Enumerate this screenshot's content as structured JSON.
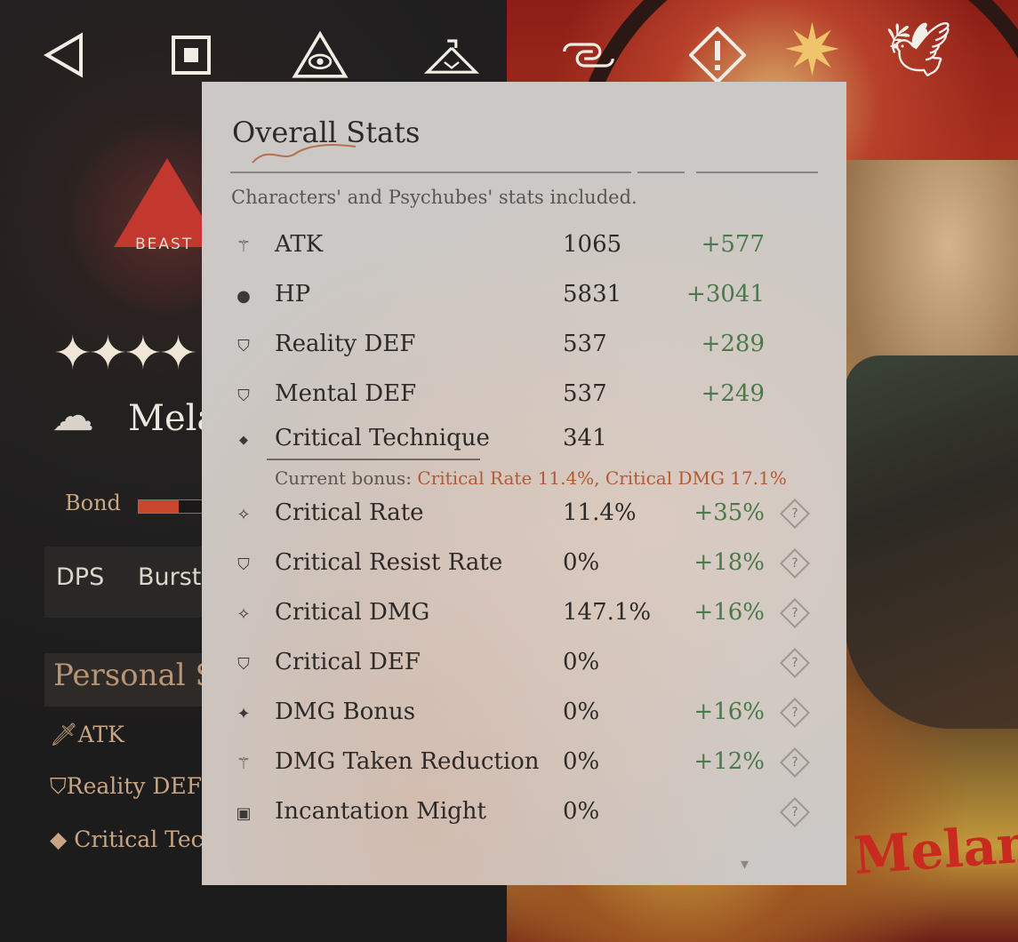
{
  "toolbar": {
    "back": "back-icon",
    "home": "home-icon",
    "eye": "eye-triangle-icon",
    "wardrobe": "hanger-icon",
    "link": "link-icon",
    "warning": "warning-icon"
  },
  "character": {
    "afflatus": "BEAST",
    "rarity": "✦✦✦✦",
    "name_partial": "Mela",
    "bond_label": "Bond",
    "bond_progress": 0.5,
    "roles": [
      "DPS",
      "Burst"
    ],
    "personal_title": "Personal S",
    "personal_stats": [
      "ATK",
      "Reality DEF",
      "Critical Tech"
    ]
  },
  "panel": {
    "title": "Overall Stats",
    "subtitle": "Characters' and Psychubes' stats included.",
    "stats": [
      {
        "name": "ATK",
        "value": "1065",
        "bonus": "+577",
        "icon": "atk-icon"
      },
      {
        "name": "HP",
        "value": "5831",
        "bonus": "+3041",
        "icon": "hp-icon"
      },
      {
        "name": "Reality DEF",
        "value": "537",
        "bonus": "+289",
        "icon": "reality-def-icon"
      },
      {
        "name": "Mental DEF",
        "value": "537",
        "bonus": "+249",
        "icon": "mental-def-icon"
      },
      {
        "name": "Critical Technique",
        "value": "341",
        "bonus": "",
        "icon": "critical-technique-icon"
      },
      {
        "name": "Critical Rate",
        "value": "11.4%",
        "bonus": "+35%",
        "icon": "critical-rate-icon"
      },
      {
        "name": "Critical Resist Rate",
        "value": "0%",
        "bonus": "+18%",
        "icon": "critical-resist-icon"
      },
      {
        "name": "Critical DMG",
        "value": "147.1%",
        "bonus": "+16%",
        "icon": "critical-dmg-icon"
      },
      {
        "name": "Critical DEF",
        "value": "0%",
        "bonus": "",
        "icon": "critical-def-icon"
      },
      {
        "name": "DMG Bonus",
        "value": "0%",
        "bonus": "+16%",
        "icon": "dmg-bonus-icon"
      },
      {
        "name": "DMG Taken Reduction",
        "value": "0%",
        "bonus": "+12%",
        "icon": "dmg-taken-reduction-icon"
      },
      {
        "name": "Incantation Might",
        "value": "0%",
        "bonus": "",
        "icon": "incantation-might-icon"
      }
    ],
    "ct_bonus_label": "Current bonus:",
    "ct_bonus_value": "Critical Rate 11.4%, Critical DMG 17.1%",
    "help_glyph": "?",
    "scroll_glyph": "▾"
  },
  "art": {
    "signature": "Melania"
  },
  "colors": {
    "bonus_green": "#4a7a4b",
    "bonus_highlight": "#b25a34",
    "panel_bg": "#cbc8c5"
  }
}
